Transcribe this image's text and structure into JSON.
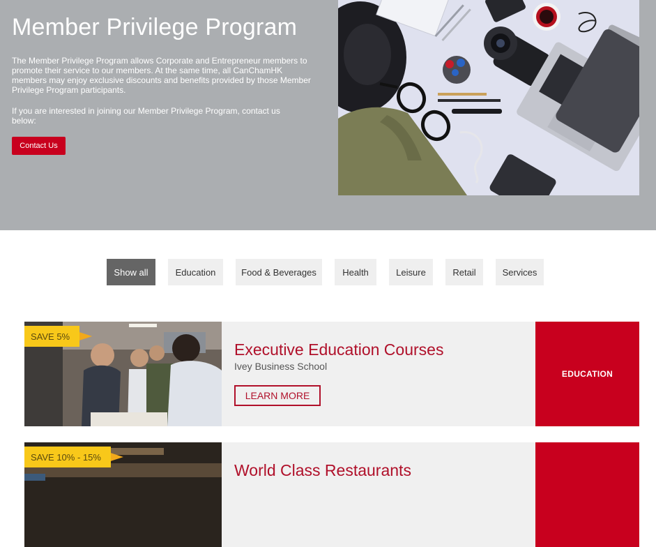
{
  "hero": {
    "title": "Member Privilege Program",
    "description": "The Member Privilege Program allows Corporate and Entrepreneur members to promote their service to our members. At the same time, all CanChamHK members may enjoy exclusive discounts and benefits provided by those Member Privilege Program participants.",
    "contact_note": "If you are interested in joining our Member Privilege Program, contact us below:",
    "contact_button": "Contact Us"
  },
  "filters": [
    {
      "label": "Show all",
      "active": true
    },
    {
      "label": "Education",
      "active": false
    },
    {
      "label": "Food & Beverages",
      "active": false
    },
    {
      "label": "Health",
      "active": false
    },
    {
      "label": "Leisure",
      "active": false
    },
    {
      "label": "Retail",
      "active": false
    },
    {
      "label": "Services",
      "active": false
    }
  ],
  "cards": [
    {
      "save": "SAVE 5%",
      "title": "Executive Education Courses",
      "subtitle": "Ivey Business School",
      "button": "LEARN MORE",
      "category": "EDUCATION"
    },
    {
      "save": "SAVE 10% - 15%",
      "title": "World Class Restaurants",
      "subtitle": "",
      "button": "",
      "category": ""
    }
  ],
  "colors": {
    "hero_bg": "#abaeb1",
    "accent_red": "#c8001e",
    "title_red": "#b0102a",
    "save_yellow": "#f8c81a",
    "filter_active": "#656565",
    "filter_bg": "#efefef"
  }
}
